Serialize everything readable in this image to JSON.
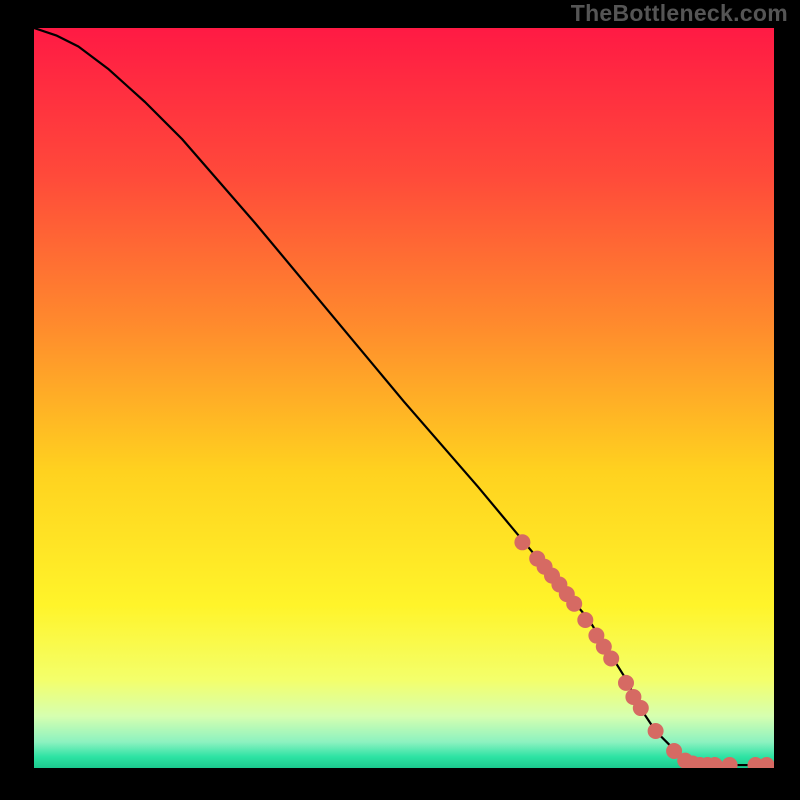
{
  "watermark": "TheBottleneck.com",
  "chart_data": {
    "type": "line",
    "title": "",
    "xlabel": "",
    "ylabel": "",
    "xlim": [
      0,
      100
    ],
    "ylim": [
      0,
      100
    ],
    "gradient_stops": [
      {
        "offset": 0.0,
        "color": "#ff1a44"
      },
      {
        "offset": 0.2,
        "color": "#ff4a3a"
      },
      {
        "offset": 0.4,
        "color": "#ff8a2d"
      },
      {
        "offset": 0.6,
        "color": "#ffd21f"
      },
      {
        "offset": 0.78,
        "color": "#fff42a"
      },
      {
        "offset": 0.88,
        "color": "#f4ff6a"
      },
      {
        "offset": 0.93,
        "color": "#d6ffb0"
      },
      {
        "offset": 0.965,
        "color": "#8cf2c0"
      },
      {
        "offset": 0.985,
        "color": "#2de3a3"
      },
      {
        "offset": 1.0,
        "color": "#1cc98e"
      }
    ],
    "curve": {
      "x": [
        0,
        3,
        6,
        10,
        15,
        20,
        30,
        40,
        50,
        60,
        70,
        75,
        80,
        82,
        84,
        86,
        88,
        90,
        100
      ],
      "y": [
        100,
        99,
        97.5,
        94.5,
        90,
        85,
        73.5,
        61.5,
        49.5,
        38,
        26,
        20,
        12,
        8,
        5,
        3,
        1.2,
        0.4,
        0.4
      ]
    },
    "scatter": {
      "color": "#d66a63",
      "radius": 8,
      "points": [
        {
          "x": 66,
          "y": 30.5
        },
        {
          "x": 68,
          "y": 28.3
        },
        {
          "x": 69,
          "y": 27.2
        },
        {
          "x": 70,
          "y": 26.0
        },
        {
          "x": 71,
          "y": 24.8
        },
        {
          "x": 72,
          "y": 23.5
        },
        {
          "x": 73,
          "y": 22.2
        },
        {
          "x": 74.5,
          "y": 20.0
        },
        {
          "x": 76,
          "y": 17.9
        },
        {
          "x": 77,
          "y": 16.4
        },
        {
          "x": 78,
          "y": 14.8
        },
        {
          "x": 80,
          "y": 11.5
        },
        {
          "x": 81,
          "y": 9.6
        },
        {
          "x": 82,
          "y": 8.1
        },
        {
          "x": 84,
          "y": 5.0
        },
        {
          "x": 86.5,
          "y": 2.3
        },
        {
          "x": 88,
          "y": 1.0
        },
        {
          "x": 89,
          "y": 0.6
        },
        {
          "x": 90,
          "y": 0.4
        },
        {
          "x": 91,
          "y": 0.4
        },
        {
          "x": 92,
          "y": 0.4
        },
        {
          "x": 94,
          "y": 0.4
        },
        {
          "x": 97.5,
          "y": 0.4
        },
        {
          "x": 99,
          "y": 0.4
        }
      ]
    }
  }
}
